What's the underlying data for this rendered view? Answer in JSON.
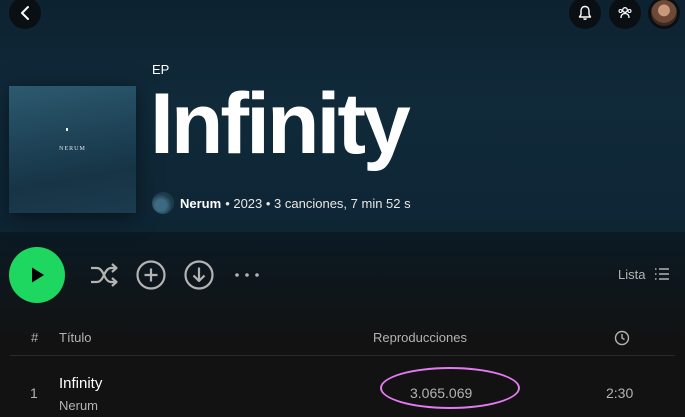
{
  "header": {
    "type_label": "EP",
    "title": "Infinity",
    "cover_text": "NERUM",
    "artist": "Nerum",
    "meta_rest": "• 2023 • 3 canciones, 7 min 52 s"
  },
  "controls": {
    "list_label": "Lista"
  },
  "table": {
    "headers": {
      "number": "#",
      "title": "Título",
      "plays": "Reproducciones"
    },
    "rows": [
      {
        "number": "1",
        "title": "Infinity",
        "artist": "Nerum",
        "plays": "3.065.069",
        "duration": "2:30"
      }
    ]
  },
  "colors": {
    "accent": "#1ed760",
    "annotation": "#e27bf0",
    "hero_bg": "#102a3a"
  },
  "icons": [
    "chevron-left-icon",
    "bell-icon",
    "friends-icon",
    "play-icon",
    "shuffle-icon",
    "add-circle-icon",
    "download-icon",
    "more-icon",
    "list-icon",
    "clock-icon"
  ]
}
